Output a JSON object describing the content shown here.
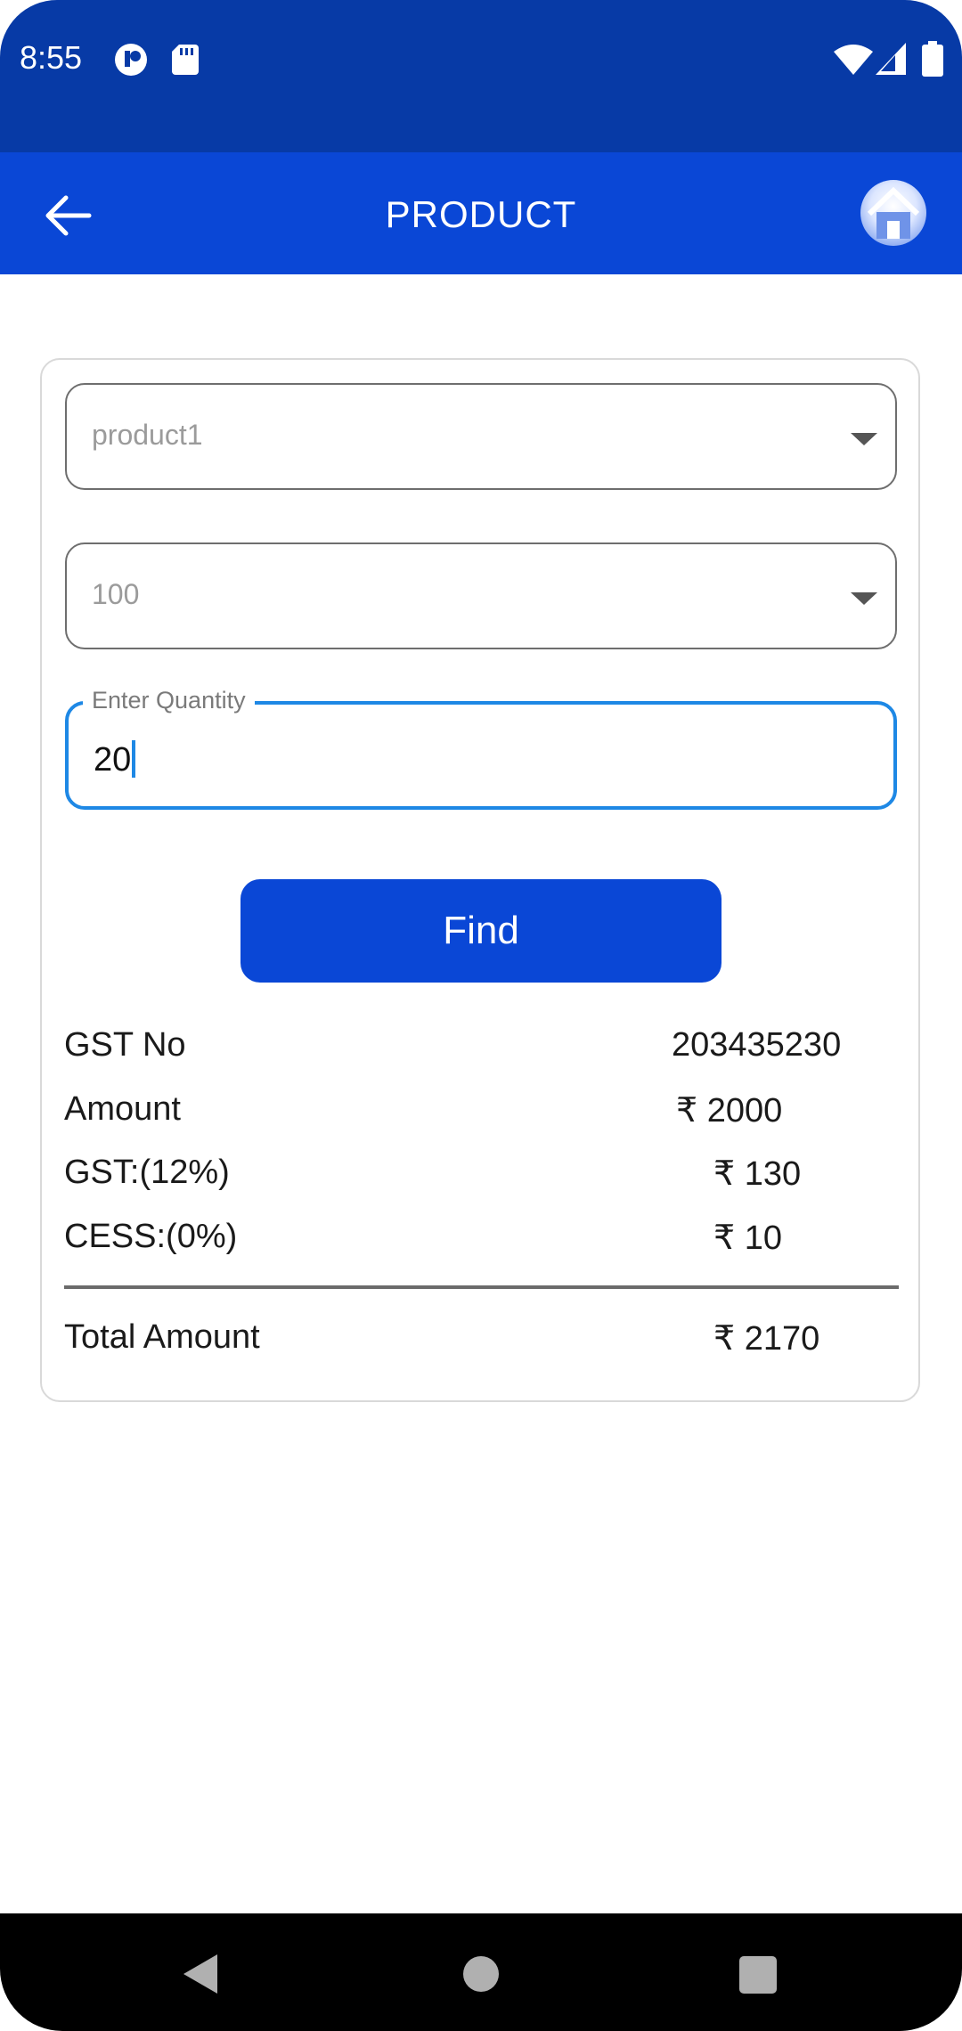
{
  "status_bar": {
    "time": "8:55",
    "icons": [
      "notification-icon",
      "sd-card-icon",
      "wifi-icon",
      "signal-icon",
      "battery-icon"
    ]
  },
  "app_bar": {
    "title": "PRODUCT",
    "back_icon": "arrow-left-icon",
    "home_icon": "home-icon"
  },
  "form": {
    "product_select": {
      "value": "product1"
    },
    "size_select": {
      "value": "100"
    },
    "quantity": {
      "label": "Enter Quantity",
      "value": "20"
    },
    "find_label": "Find"
  },
  "summary": {
    "rows": [
      {
        "label": "GST No",
        "value": "203435230"
      },
      {
        "label": "Amount",
        "value": "₹ 2000"
      },
      {
        "label": "GST:(12%)",
        "value": "₹ 130"
      },
      {
        "label": "CESS:(0%)",
        "value": "₹ 10"
      }
    ],
    "total": {
      "label": "Total Amount",
      "value": "₹ 2170"
    }
  },
  "colors": {
    "status_bar": "#073aa6",
    "app_bar": "#0a47d6",
    "accent": "#1e88e5",
    "button": "#0a47d6"
  }
}
